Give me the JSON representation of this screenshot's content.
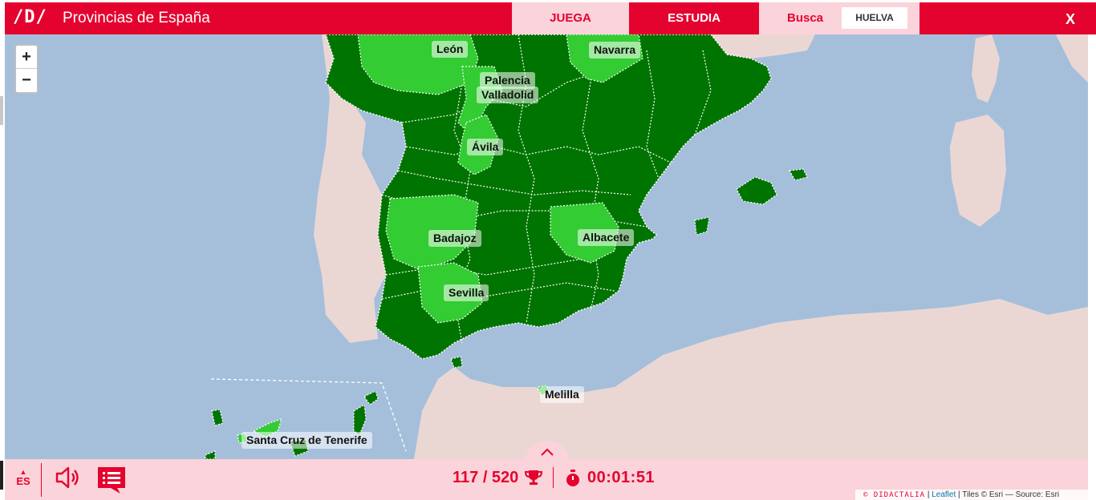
{
  "header": {
    "logo": "/D/",
    "title": "Provincias de España",
    "tab_play": "JUEGA",
    "tab_study": "ESTUDIA",
    "search_label": "Busca",
    "search_target": "HUELVA",
    "close": "X"
  },
  "map": {
    "zoom_in": "+",
    "zoom_out": "−",
    "labels": {
      "leon": "León",
      "navarra": "Navarra",
      "palencia": "Palencia",
      "valladolid": "Valladolid",
      "avila": "Ávila",
      "badajoz": "Badajoz",
      "albacete": "Albacete",
      "sevilla": "Sevilla",
      "melilla": "Melilla",
      "tenerife": "Santa Cruz de Tenerife"
    },
    "colors": {
      "sea": "#a5bfdb",
      "land": "#ead7d4",
      "province_dark": "#007400",
      "province_light": "#33cc33",
      "border": "#ffffff"
    }
  },
  "footer": {
    "lang": "ES",
    "score": "117 / 520",
    "timer": "00:01:51",
    "attribution_brand": "© DIDACTALIA",
    "attribution_sep": "|",
    "attribution_leaflet": "Leaflet",
    "attribution_rest": "| Tiles © Esri — Source: Esri"
  },
  "icons": {
    "sound": "speaker-icon",
    "chat": "chat-list-icon",
    "trophy": "trophy-icon",
    "timer": "stopwatch-icon",
    "expand": "chevron-up-icon"
  },
  "accent": "#e4032e"
}
